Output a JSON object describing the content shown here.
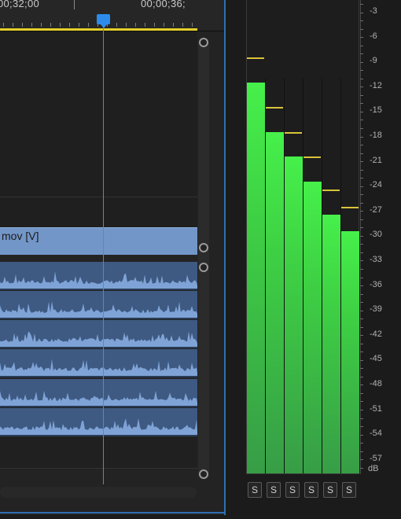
{
  "timeline": {
    "timecode_left": "00;32;00",
    "timecode_right": "00;00;36;",
    "video_clip_label": "mov [V]",
    "colors": {
      "playhead": "#2d8ceb",
      "work_area": "#e4cf2a",
      "video_clip": "#7396c8",
      "audio_clip": "#3e5a82",
      "waveform": "#7fa3d6"
    }
  },
  "meters": {
    "db_scale": [
      "-3",
      "-6",
      "-9",
      "-12",
      "-15",
      "-18",
      "-21",
      "-24",
      "-27",
      "-30",
      "-33",
      "-36",
      "-39",
      "-42",
      "-45",
      "-48",
      "-51",
      "-54",
      "-57",
      "dB"
    ],
    "channel_levels_db": [
      -11.5,
      -17.5,
      -20.5,
      -23.5,
      -27.5,
      -29.5
    ],
    "channel_peaks_db": [
      -8.5,
      -14.5,
      -17.5,
      -20.5,
      -24.5,
      -26.5
    ],
    "solo_buttons": [
      "S",
      "S",
      "S",
      "S",
      "S",
      "S"
    ],
    "scale_range_db": [
      -60,
      0
    ],
    "colors": {
      "meter_top": "#46f04a",
      "meter_bottom": "#379d46",
      "peak": "#d9c43a"
    }
  }
}
